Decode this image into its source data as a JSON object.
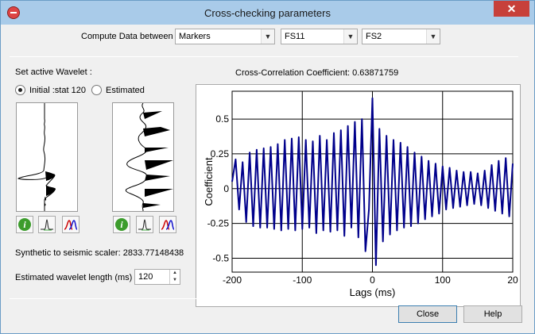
{
  "window": {
    "title": "Cross-checking parameters",
    "close_glyph": "✕"
  },
  "compute": {
    "label": "Compute Data between",
    "type_value": "Markers",
    "from_value": "FS11",
    "to_value": "FS2"
  },
  "wavelet": {
    "label": "Set active Wavelet :",
    "initial_label": "Initial :stat 120",
    "estimated_label": "Estimated",
    "selected": "initial",
    "scaler_text": "Synthetic to seismic scaler: 2833.77148438",
    "length_label": "Estimated wavelet length (ms)",
    "length_value": "120"
  },
  "plot_title": "Cross-Correlation Coefficient: 0.63871759",
  "chart_data": {
    "type": "line",
    "xlabel": "Lags (ms)",
    "ylabel": "Coefficient",
    "xlim": [
      -200,
      200
    ],
    "ylim": [
      -0.6,
      0.7
    ],
    "xticks": [
      "-200",
      "-100",
      "0",
      "100",
      "20"
    ],
    "yticks": [
      "0.5",
      "0.25",
      "0",
      "-0.25",
      "-0.5"
    ],
    "series": [
      {
        "color": "#00008b",
        "x": [
          -200,
          -195,
          -190,
          -185,
          -180,
          -175,
          -170,
          -165,
          -160,
          -155,
          -150,
          -145,
          -140,
          -135,
          -130,
          -125,
          -120,
          -115,
          -110,
          -105,
          -100,
          -95,
          -90,
          -85,
          -80,
          -75,
          -70,
          -65,
          -60,
          -55,
          -50,
          -45,
          -40,
          -35,
          -30,
          -25,
          -20,
          -15,
          -10,
          -5,
          0,
          5,
          10,
          15,
          20,
          25,
          30,
          35,
          40,
          45,
          50,
          55,
          60,
          65,
          70,
          75,
          80,
          85,
          90,
          95,
          100,
          105,
          110,
          115,
          120,
          125,
          130,
          135,
          140,
          145,
          150,
          155,
          160,
          165,
          170,
          175,
          180,
          185,
          190,
          195,
          200
        ],
        "values": [
          0.05,
          0.21,
          -0.15,
          0.19,
          -0.24,
          0.26,
          -0.27,
          0.28,
          -0.28,
          0.29,
          -0.28,
          0.3,
          -0.29,
          0.32,
          -0.3,
          0.35,
          -0.29,
          0.36,
          -0.3,
          0.37,
          -0.29,
          0.35,
          -0.28,
          0.34,
          -0.32,
          0.38,
          -0.3,
          0.35,
          -0.31,
          0.4,
          -0.3,
          0.42,
          -0.34,
          0.45,
          -0.28,
          0.48,
          -0.35,
          0.5,
          -0.45,
          -0.15,
          0.65,
          -0.55,
          0.43,
          -0.38,
          0.38,
          -0.33,
          0.35,
          -0.3,
          0.33,
          -0.28,
          0.3,
          -0.27,
          0.26,
          -0.25,
          0.23,
          -0.22,
          0.2,
          -0.2,
          0.18,
          -0.18,
          0.16,
          -0.15,
          0.15,
          -0.14,
          0.13,
          -0.13,
          0.12,
          -0.12,
          0.12,
          -0.11,
          0.11,
          -0.12,
          0.13,
          -0.14,
          0.17,
          -0.16,
          0.2,
          -0.18,
          0.22,
          -0.2,
          0.18
        ]
      }
    ]
  },
  "buttons": {
    "close": "Close",
    "help": "Help"
  }
}
